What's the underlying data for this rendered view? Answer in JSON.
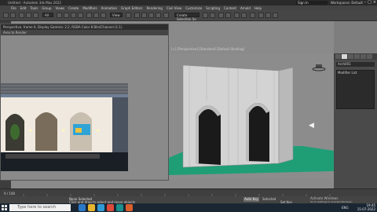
{
  "window": {
    "title": "Untitled - Autodesk 3ds Max 2022",
    "sign_in": "Sign In",
    "workspace_label": "Workspaces: Default"
  },
  "menus": [
    "File",
    "Edit",
    "Tools",
    "Group",
    "Views",
    "Create",
    "Modifiers",
    "Animation",
    "Graph Editors",
    "Rendering",
    "Civil View",
    "Customize",
    "Scripting",
    "Content",
    "Arnold",
    "Help"
  ],
  "toolbar": {
    "selection_filter": "All",
    "view_field": "View",
    "create_selection_set": "Create Selection Se"
  },
  "render_window": {
    "title": "Perspective, frame 0, Display Gamma: 2.2, RGBA Color 8 Bits/Channel (1:1)",
    "toolbar_label": "Area to Render"
  },
  "viewport": {
    "label": "[+] [Perspective] [Standard] [Default Shading]"
  },
  "command_panel": {
    "object_name": "Arch001",
    "modifier_list_label": "Modifier List"
  },
  "status": {
    "selection": "None Selected",
    "prompt": "Click and drag to select and move objects",
    "frame_counter": "0 / 100",
    "auto_key": "Auto Key",
    "set_key": "Set Key",
    "selected_dropdown": "Selected",
    "activate_windows": "Activate Windows",
    "activate_sub": "Go to Settings to activate Windows."
  },
  "taskbar": {
    "search_placeholder": "Type here to search",
    "time": "19:45",
    "date": "15-07-2022",
    "lang": "ENG"
  },
  "colors": {
    "ground": "#1f9e76",
    "wall": "#d0d0d0",
    "viewport_bg": "#8c8c8c",
    "render_floor": "#1a1f26"
  }
}
